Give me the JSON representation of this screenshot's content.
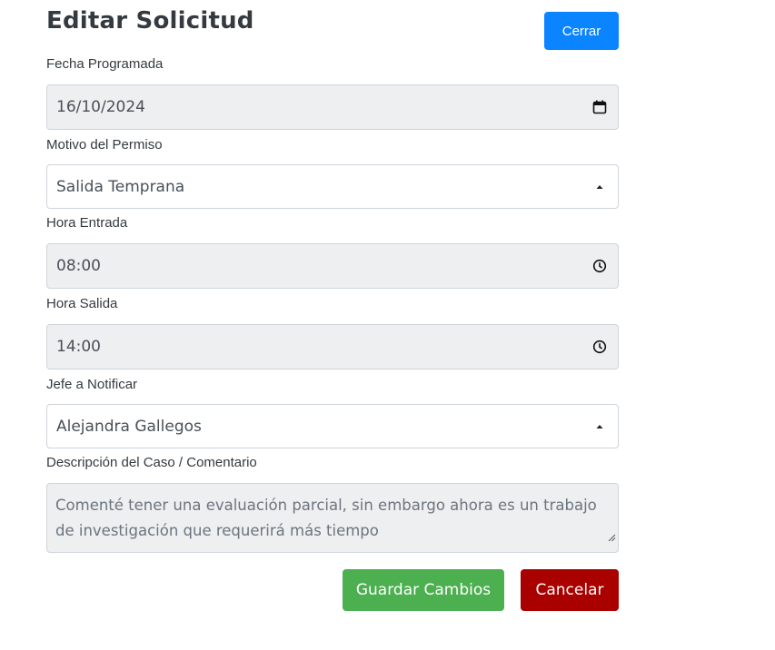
{
  "form": {
    "title": "Editar Solicitud",
    "close_label": "Cerrar",
    "fecha": {
      "label": "Fecha Programada",
      "value": "16/10/2024"
    },
    "motivo": {
      "label": "Motivo del Permiso",
      "value": "Salida Temprana"
    },
    "hora_entrada": {
      "label": "Hora Entrada",
      "value": "08:00"
    },
    "hora_salida": {
      "label": "Hora Salida",
      "value": "14:00"
    },
    "jefe": {
      "label": "Jefe a Notificar",
      "value": "Alejandra Gallegos"
    },
    "descripcion": {
      "label": "Descripción del Caso / Comentario",
      "value": "Comenté tener una evaluación parcial, sin embargo ahora es un trabajo de investigación que requerirá más tiempo"
    },
    "save_label": "Guardar Cambios",
    "cancel_label": "Cancelar"
  },
  "icons": {
    "date": "calendar-icon",
    "time": "clock-icon",
    "select": "caret-up-icon",
    "resize": "resize-grip-icon"
  },
  "colors": {
    "primary": "#0a84ff",
    "success": "#4caf50",
    "danger": "#a90000",
    "disabled_bg": "#eeeff1"
  }
}
